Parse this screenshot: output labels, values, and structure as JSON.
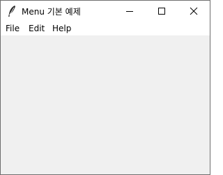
{
  "window": {
    "title": "Menu 기본 예제",
    "app_icon": "feather-icon"
  },
  "title_controls": {
    "minimize_icon": "minimize-icon",
    "maximize_icon": "maximize-icon",
    "close_icon": "close-icon"
  },
  "menubar": {
    "items": [
      {
        "label": "File"
      },
      {
        "label": "Edit"
      },
      {
        "label": "Help"
      }
    ]
  },
  "colors": {
    "titlebar_bg": "#ffffff",
    "menubar_bg": "#ffffff",
    "client_bg": "#f0f0f0",
    "border": "#6e6e6e"
  }
}
